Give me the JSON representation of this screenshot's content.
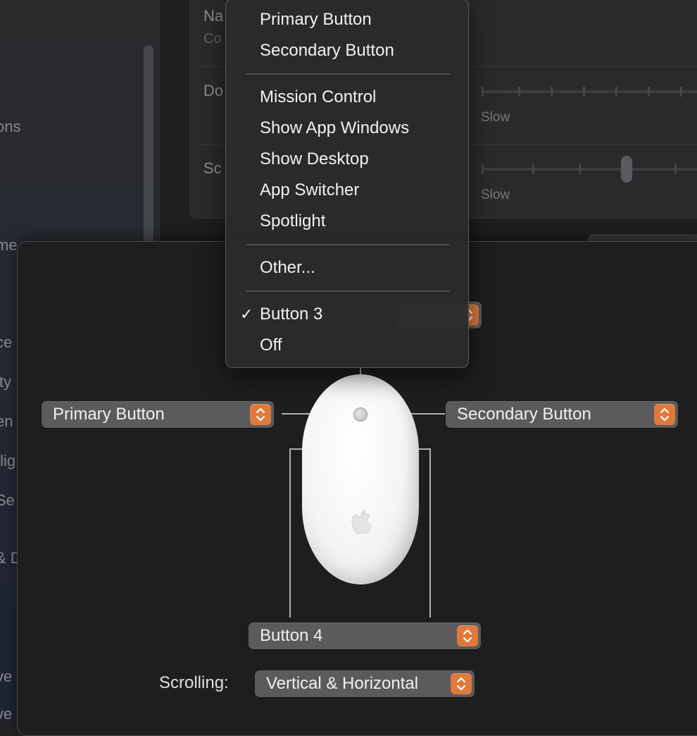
{
  "sidebar": {
    "items": [
      "ons",
      "me",
      "ce",
      "ity",
      "en",
      "tlig",
      "Se",
      "& D",
      "ve",
      "ve"
    ]
  },
  "settings": {
    "row1_label": "Na",
    "row1_sub": "Co",
    "row2_label": "Do",
    "row2_slow": "Slow",
    "row3_label": "Sc",
    "row3_slow": "Slow"
  },
  "menu": {
    "group1": [
      "Primary Button",
      "Secondary Button"
    ],
    "group2": [
      "Mission Control",
      "Show App Windows",
      "Show Desktop",
      "App Switcher",
      "Spotlight"
    ],
    "group3": [
      "Other..."
    ],
    "group4": [
      "Button 3",
      "Off"
    ],
    "checked_item": "Button 3",
    "checkmark": "✓"
  },
  "buttons": {
    "left": "Primary Button",
    "right": "Secondary Button",
    "side": "Button 4"
  },
  "scrolling": {
    "label": "Scrolling:",
    "value": "Vertical & Horizontal"
  },
  "colors": {
    "accent": "#e0793a",
    "popup_bg": "#5b5b5e",
    "menu_bg": "#2a2a2c"
  }
}
